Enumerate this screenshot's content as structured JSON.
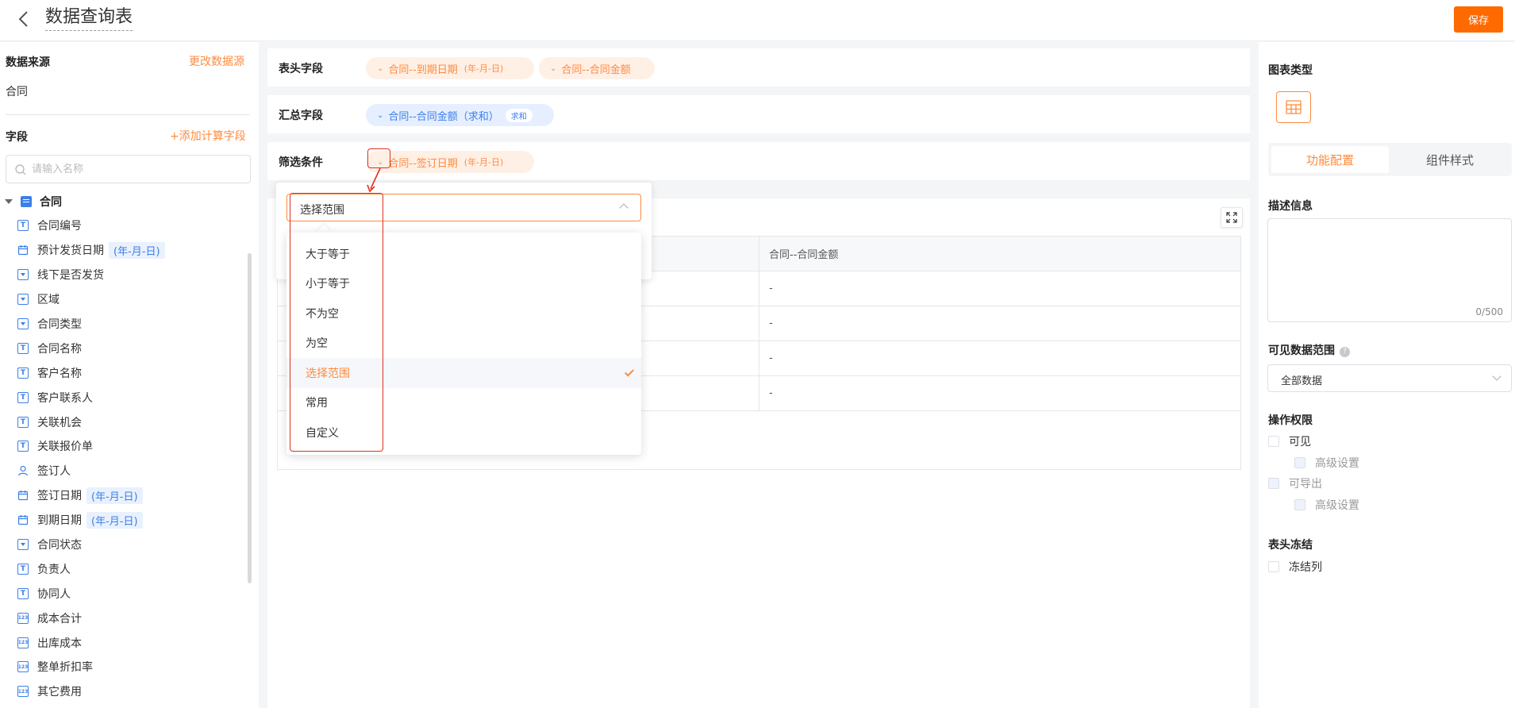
{
  "header": {
    "title": "数据查询表",
    "save_label": "保存"
  },
  "sidebar": {
    "source_label": "数据来源",
    "change_source": "更改数据源",
    "source_value": "合同",
    "fields_label": "字段",
    "add_calc_field": "+添加计算字段",
    "search_placeholder": "请输入名称",
    "root": "合同",
    "date_format": "(年-月-日)",
    "items": [
      {
        "label": "合同编号",
        "icon": "text-field-icon"
      },
      {
        "label": "预计发货日期",
        "icon": "calendar-icon",
        "tag": "(年-月-日)"
      },
      {
        "label": "线下是否发货",
        "icon": "dropdown-field-icon"
      },
      {
        "label": "区域",
        "icon": "dropdown-field-icon"
      },
      {
        "label": "合同类型",
        "icon": "dropdown-field-icon"
      },
      {
        "label": "合同名称",
        "icon": "text-field-icon"
      },
      {
        "label": "客户名称",
        "icon": "text-field-icon"
      },
      {
        "label": "客户联系人",
        "icon": "text-field-icon"
      },
      {
        "label": "关联机会",
        "icon": "text-field-icon"
      },
      {
        "label": "关联报价单",
        "icon": "text-field-icon"
      },
      {
        "label": "签订人",
        "icon": "user-icon"
      },
      {
        "label": "签订日期",
        "icon": "calendar-icon",
        "tag": "(年-月-日)"
      },
      {
        "label": "到期日期",
        "icon": "calendar-icon",
        "tag": "(年-月-日)"
      },
      {
        "label": "合同状态",
        "icon": "dropdown-field-icon"
      },
      {
        "label": "负责人",
        "icon": "text-field-icon"
      },
      {
        "label": "协同人",
        "icon": "text-field-icon"
      },
      {
        "label": "成本合计",
        "icon": "number-field-icon"
      },
      {
        "label": "出库成本",
        "icon": "number-field-icon"
      },
      {
        "label": "整单折扣率",
        "icon": "number-field-icon"
      },
      {
        "label": "其它费用",
        "icon": "number-field-icon"
      }
    ]
  },
  "zones": {
    "header_fields": {
      "label": "表头字段",
      "pills": [
        {
          "text": "合同--到期日期",
          "fmt": "(年-月-日)"
        },
        {
          "text": "合同--合同金额"
        }
      ]
    },
    "summary_fields": {
      "label": "汇总字段",
      "pill": {
        "text": "合同--合同金额（求和）",
        "tag": "求和"
      }
    },
    "filters": {
      "label": "筛选条件",
      "pill": {
        "text": "合同--签订日期",
        "fmt": "(年-月-日)"
      }
    }
  },
  "table": {
    "columns": [
      "",
      "合同--合同金额"
    ],
    "rows": [
      [
        "",
        "-"
      ],
      [
        "",
        "-"
      ],
      [
        "",
        "-"
      ],
      [
        "",
        "-"
      ]
    ]
  },
  "dropdown": {
    "selected": "选择范围",
    "options": [
      "大于等于",
      "小于等于",
      "不为空",
      "为空",
      "选择范围",
      "常用",
      "自定义"
    ],
    "selected_index": 4
  },
  "right": {
    "chart_type_label": "图表类型",
    "tab_active": "功能配置",
    "tab_other": "组件样式",
    "desc_label": "描述信息",
    "desc_counter": "0/500",
    "visible_range_label": "可见数据范围",
    "help": "?",
    "visible_range_value": "全部数据",
    "permissions_label": "操作权限",
    "visible": "可见",
    "advanced1": "高级设置",
    "exportable": "可导出",
    "advanced2": "高级设置",
    "freeze_label": "表头冻结",
    "freeze_col": "冻结列"
  }
}
